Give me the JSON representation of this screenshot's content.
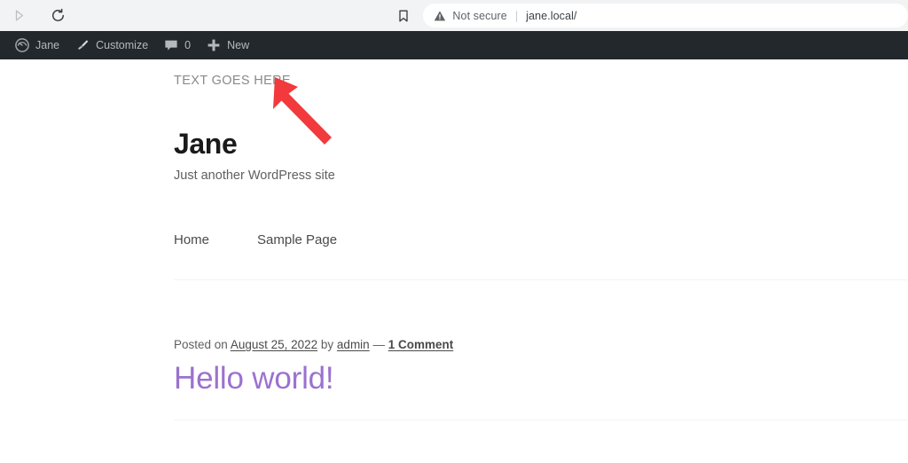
{
  "browser": {
    "forward_icon": "forward-arrow-icon",
    "reload_icon": "reload-icon",
    "bookmark_icon": "bookmark-icon",
    "security_icon": "warning-triangle-icon",
    "security_label": "Not secure",
    "separator": "|",
    "url": "jane.local/"
  },
  "admin_bar": {
    "items": [
      {
        "icon": "wordpress-dashboard-icon",
        "label": "Jane"
      },
      {
        "icon": "paintbrush-icon",
        "label": "Customize"
      },
      {
        "icon": "comment-bubble-icon",
        "label": "0"
      },
      {
        "icon": "plus-icon",
        "label": "New"
      }
    ]
  },
  "site": {
    "top_text": "TEXT GOES HERE",
    "title": "Jane",
    "description": "Just another WordPress site",
    "nav": [
      {
        "label": "Home"
      },
      {
        "label": "Sample Page"
      }
    ]
  },
  "post": {
    "meta_prefix": "Posted on ",
    "date": "August 25, 2022",
    "meta_by": " by ",
    "author": "admin",
    "meta_dash": " — ",
    "comments": "1 Comment",
    "title": "Hello world!"
  },
  "annotation": {
    "arrow_name": "red-pointer-arrow",
    "color": "#f2393c"
  },
  "colors": {
    "admin_bar_bg": "#23282d",
    "toolbar_bg": "#f1f3f4",
    "post_title": "#9b72cf",
    "accent_red": "#f2393c"
  }
}
